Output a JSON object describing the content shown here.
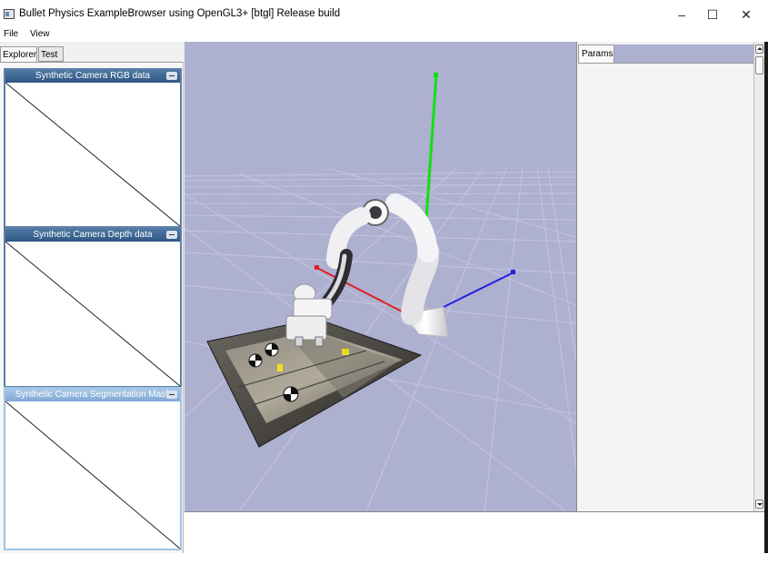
{
  "window": {
    "title": "Bullet Physics ExampleBrowser using OpenGL3+ [btgl] Release build",
    "controls": {
      "minimize": "–",
      "maximize": "☐",
      "close": "✕"
    }
  },
  "menu": {
    "items": [
      {
        "label": "File"
      },
      {
        "label": "View"
      }
    ]
  },
  "left_tabs": [
    {
      "label": "Explorer",
      "active": true
    },
    {
      "label": "Test",
      "active": false
    }
  ],
  "camera_windows": [
    {
      "title": "Synthetic Camera RGB data",
      "active": false
    },
    {
      "title": "Synthetic Camera Depth data",
      "active": false
    },
    {
      "title": "Synthetic Camera Segmentation Mask",
      "active": true
    }
  ],
  "params": {
    "tab_label": "Params"
  },
  "viewport": {
    "background": "#aeb0d0",
    "axis_colors": {
      "x": "#e02020",
      "y": "#10e010",
      "z": "#2020e0"
    }
  }
}
